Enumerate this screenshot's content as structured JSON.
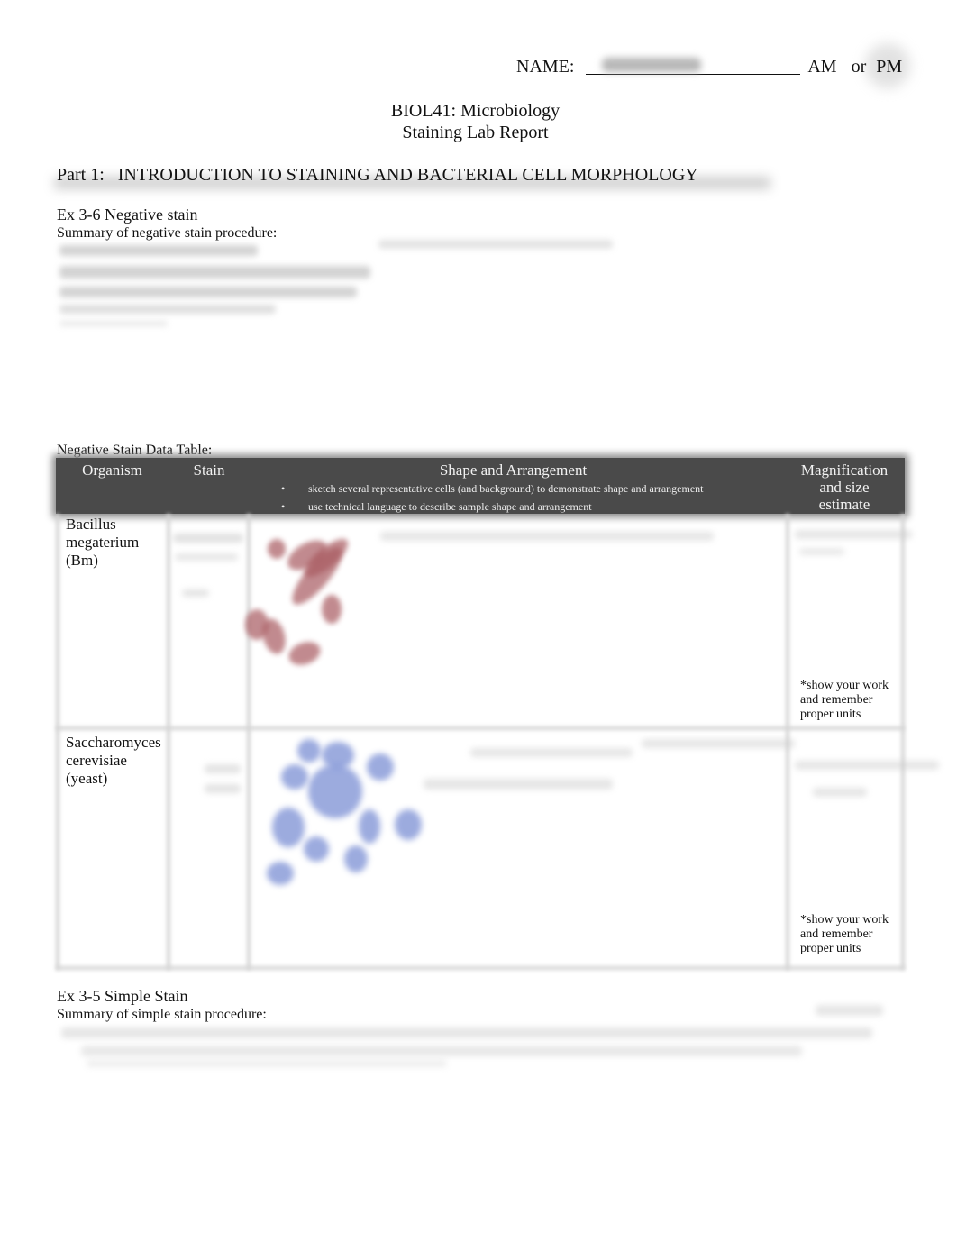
{
  "header": {
    "name_label": "NAME:",
    "name_value_redacted": true,
    "am_label": "AM",
    "or_label": "or",
    "pm_label": "PM",
    "pm_circled": true
  },
  "title": {
    "course": "BIOL41: Microbiology",
    "report": "Staining Lab Report"
  },
  "part1": {
    "heading": "Part 1:   INTRODUCTION TO STAINING AND BACTERIAL CELL MORPHOLOGY"
  },
  "negative_stain": {
    "heading": "Ex 3-6 Negative stain",
    "summary_label": "Summary of negative stain procedure:",
    "table_label": "Negative Stain Data Table:",
    "columns": {
      "organism": "Organism",
      "stain": "Stain",
      "shape": "Shape and Arrangement",
      "shape_bullets": [
        "sketch several representative cells (and background) to demonstrate shape and arrangement",
        "use technical language to describe sample shape and arrangement"
      ],
      "magnification": [
        "Magnification",
        "and size",
        "estimate"
      ]
    },
    "rows": [
      {
        "organism": [
          "Bacillus",
          "megaterium",
          "(Bm)"
        ],
        "sketch_color": "#a85a60",
        "note": [
          "*show your work",
          "and remember",
          "proper units"
        ]
      },
      {
        "organism": [
          "Saccharomyces",
          "cerevisiae",
          "(yeast)"
        ],
        "sketch_color": "#7b8fd4",
        "note": [
          "*show your work",
          "and remember",
          "proper units"
        ]
      }
    ],
    "bullet": "•"
  },
  "simple_stain": {
    "heading": "Ex 3-5 Simple Stain",
    "summary_label": "Summary of simple stain procedure:"
  }
}
